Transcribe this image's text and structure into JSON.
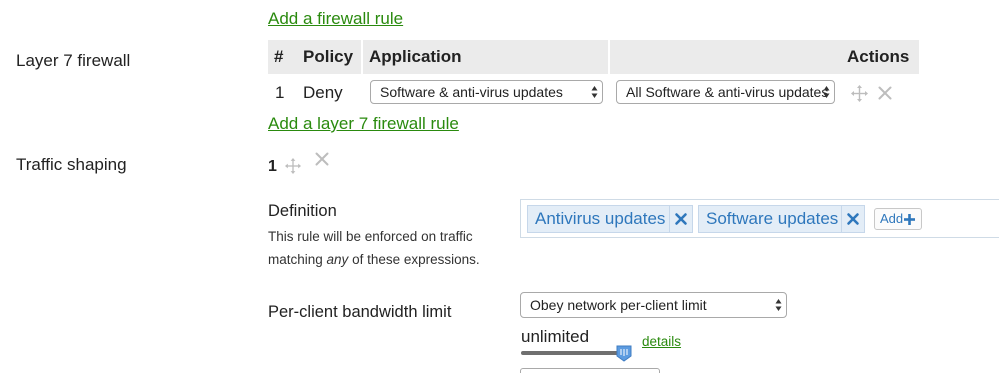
{
  "links": {
    "add_firewall_rule": "Add a firewall rule",
    "add_layer7_rule": "Add a layer 7 firewall rule",
    "details": "details"
  },
  "layer7": {
    "label": "Layer 7 firewall",
    "headers": [
      "#",
      "Policy",
      "Application",
      "",
      "Actions"
    ],
    "rows": [
      {
        "number": "1",
        "policy": "Deny",
        "application": "Software & anti-virus updates",
        "sub_application": "All Software & anti-virus updates"
      }
    ]
  },
  "traffic_shaping": {
    "label": "Traffic shaping",
    "rule_number": "1",
    "definition": {
      "heading": "Definition",
      "help_line1": "This rule will be enforced on traffic",
      "help_line2_pre": "matching ",
      "help_line2_em": "any",
      "help_line2_post": " of these expressions.",
      "tags": [
        "Antivirus updates",
        "Software updates"
      ],
      "add_label": "Add"
    },
    "bandwidth": {
      "heading": "Per-client bandwidth limit",
      "selected": "Obey network per-client limit",
      "value": "unlimited",
      "slider_fraction": 1.0
    }
  },
  "colors": {
    "link": "#2a8a0e",
    "header_bg": "#ebebeb",
    "tag_text": "#2e77bc",
    "tag_bg": "#e3edf7",
    "icon_gray": "#bdbdbd",
    "slider_thumb": "#5c9be0"
  },
  "icons": {
    "move": "move-icon",
    "delete": "close-icon",
    "tag_remove": "tag-remove-icon",
    "add": "plus-icon",
    "select_arrows": "select-arrows-icon"
  }
}
